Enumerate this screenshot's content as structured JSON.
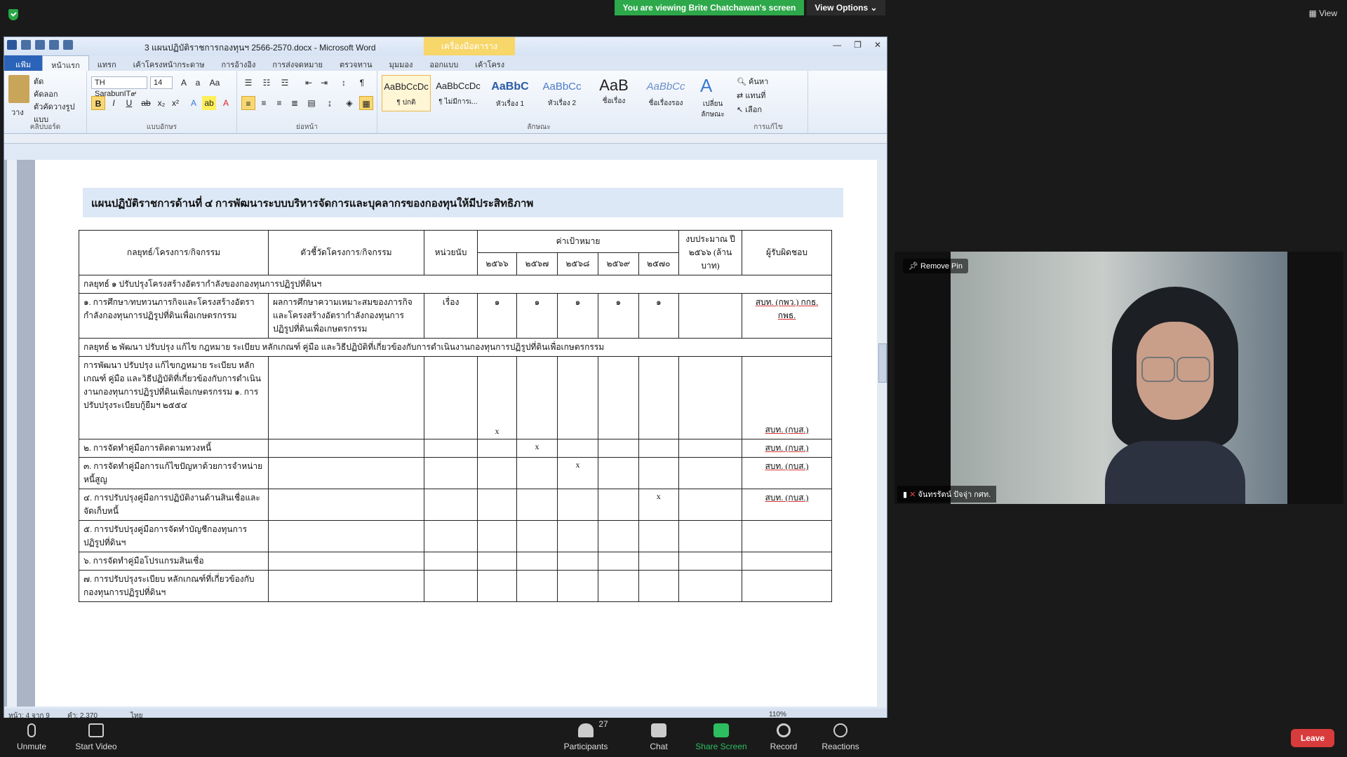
{
  "zoom": {
    "sharing_banner": "You are viewing Brite Chatchawan's screen",
    "view_options": "View Options",
    "view_top": "View",
    "remove_pin": "Remove Pin",
    "participant_name": "จันทรรัตน์ ปัจจุ่า กศท.",
    "participant_count": "27",
    "controls": {
      "unmute": "Unmute",
      "start_video": "Start Video",
      "participants": "Participants",
      "chat": "Chat",
      "share_screen": "Share Screen",
      "record": "Record",
      "reactions": "Reactions",
      "leave": "Leave"
    }
  },
  "word": {
    "title": "3 แผนปฏิบัติราชการกองทุนฯ 2566-2570.docx - Microsoft Word",
    "context_tab": "เครื่องมือตาราง",
    "tabs": [
      "แฟ้ม",
      "หน้าแรก",
      "แทรก",
      "เค้าโครงหน้ากระดาษ",
      "การอ้างอิง",
      "การส่งจดหมาย",
      "ตรวจทาน",
      "มุมมอง",
      "ออกแบบ",
      "เค้าโครง"
    ],
    "ribbon": {
      "paste": "วาง",
      "cut": "ตัด",
      "copy": "คัดลอก",
      "format_painter": "ตัวคัดวางรูปแบบ",
      "clipboard_label": "คลิปบอร์ด",
      "font_name": "TH SarabunIT๙",
      "font_size": "14",
      "font_label": "แบบอักษร",
      "paragraph_label": "ย่อหน้า",
      "styles_label": "ลักษณะ",
      "editing_label": "การแก้ไข",
      "find": "ค้นหา",
      "replace": "แทนที่",
      "select": "เลือก",
      "change_styles": "เปลี่ยน ลักษณะ",
      "styles": [
        {
          "sample": "AaBbCcDc",
          "name": "¶ ปกติ"
        },
        {
          "sample": "AaBbCcDc",
          "name": "¶ ไม่มีการเ..."
        },
        {
          "sample": "AaBbC",
          "name": "หัวเรื่อง 1"
        },
        {
          "sample": "AaBbCc",
          "name": "หัวเรื่อง 2"
        },
        {
          "sample": "AaB",
          "name": "ชื่อเรื่อง"
        },
        {
          "sample": "AaBbCc",
          "name": "ชื่อเรื่องรอง"
        }
      ]
    },
    "status": {
      "page": "หน้า: 4 จาก 9",
      "words": "คำ: 2,370",
      "language": "ไทย",
      "zoom": "110%"
    }
  },
  "document": {
    "heading": "แผนปฏิบัติราชการด้านที่ ๔ การพัฒนาระบบบริหารจัดการและบุคลากรของกองทุนให้มีประสิทธิภาพ",
    "table_headers": {
      "strategy": "กลยุทธ์/โครงการ/กิจกรรม",
      "indicator": "ตัวชี้วัดโครงการ/กิจกรรม",
      "unit": "หน่วยนับ",
      "target": "ค่าเป้าหมาย",
      "years": [
        "๒๕๖๖",
        "๒๕๖๗",
        "๒๕๖๘",
        "๒๕๖๙",
        "๒๕๗๐"
      ],
      "budget": "งบประมาณ ปี ๒๕๖๖ (ล้านบาท)",
      "responsible": "ผู้รับผิดชอบ"
    },
    "strategy1": "กลยุทธ์ ๑ ปรับปรุงโครงสร้างอัตรากำลังของกองทุนการปฏิรูปที่ดินฯ",
    "row1": {
      "activity": "๑. การศึกษา/ทบทวนภารกิจและโครงสร้างอัตรากำลังกองทุนการปฏิรูปที่ดินเพื่อเกษตรกรรม",
      "indicator": "ผลการศึกษาความเหมาะสมของภารกิจและโครงสร้างอัตรากำลังกองทุนการปฏิรูปที่ดินเพื่อเกษตรกรรม",
      "unit": "เรื่อง",
      "targets": [
        "๑",
        "๑",
        "๑",
        "๑",
        "๑"
      ],
      "responsible": "สบท. (กพว.) กกธ. กพธ."
    },
    "strategy2": "กลยุทธ์ ๒ พัฒนา ปรับปรุง แก้ไข กฎหมาย ระเบียบ หลักเกณฑ์ คู่มือ และวิธีปฏิบัติที่เกี่ยวข้องกับการดำเนินงานกองทุนการปฏิรูปที่ดินเพื่อเกษตรกรรม",
    "rows2": [
      {
        "activity": "การพัฒนา ปรับปรุง แก้ไขกฎหมาย ระเบียบ หลักเกณฑ์ คู่มือ และวิธีปฏิบัติที่เกี่ยวข้องกับการดำเนินงานกองทุนการปฏิรูปที่ดินเพื่อเกษตรกรรม ๑. การปรับปรุงระเบียบกู้ยืมฯ ๒๕๕๔",
        "marks": [
          "x",
          "",
          "",
          "",
          ""
        ],
        "responsible": "สบท. (กบส.)"
      },
      {
        "activity": "๒. การจัดทำคู่มือการติดตามทวงหนี้",
        "marks": [
          "",
          "x",
          "",
          "",
          ""
        ],
        "responsible": "สบท. (กบส.)"
      },
      {
        "activity": "๓. การจัดทำคู่มือการแก้ไขปัญหาด้วยการจำหน่ายหนี้สูญ",
        "marks": [
          "",
          "",
          "x",
          "",
          ""
        ],
        "responsible": "สบท. (กบส.)"
      },
      {
        "activity": "๔. การปรับปรุงคู่มือการปฏิบัติงานด้านสินเชื่อและจัดเก็บหนี้",
        "marks": [
          "",
          "",
          "",
          "",
          "x"
        ],
        "responsible": "สบท. (กบส.)"
      },
      {
        "activity": "๕. การปรับปรุงคู่มือการจัดทำบัญชีกองทุนการปฏิรูปที่ดินฯ",
        "marks": [
          "",
          "",
          "",
          "",
          ""
        ],
        "responsible": ""
      },
      {
        "activity": "๖. การจัดทำคู่มือโปรแกรมสินเชื่อ",
        "marks": [
          "",
          "",
          "",
          "",
          ""
        ],
        "responsible": ""
      },
      {
        "activity": "๗. การปรับปรุงระเบียบ หลักเกณฑ์ที่เกี่ยวข้องกับกองทุนการปฏิรูปที่ดินฯ",
        "marks": [
          "",
          "",
          "",
          "",
          ""
        ],
        "responsible": ""
      }
    ]
  }
}
